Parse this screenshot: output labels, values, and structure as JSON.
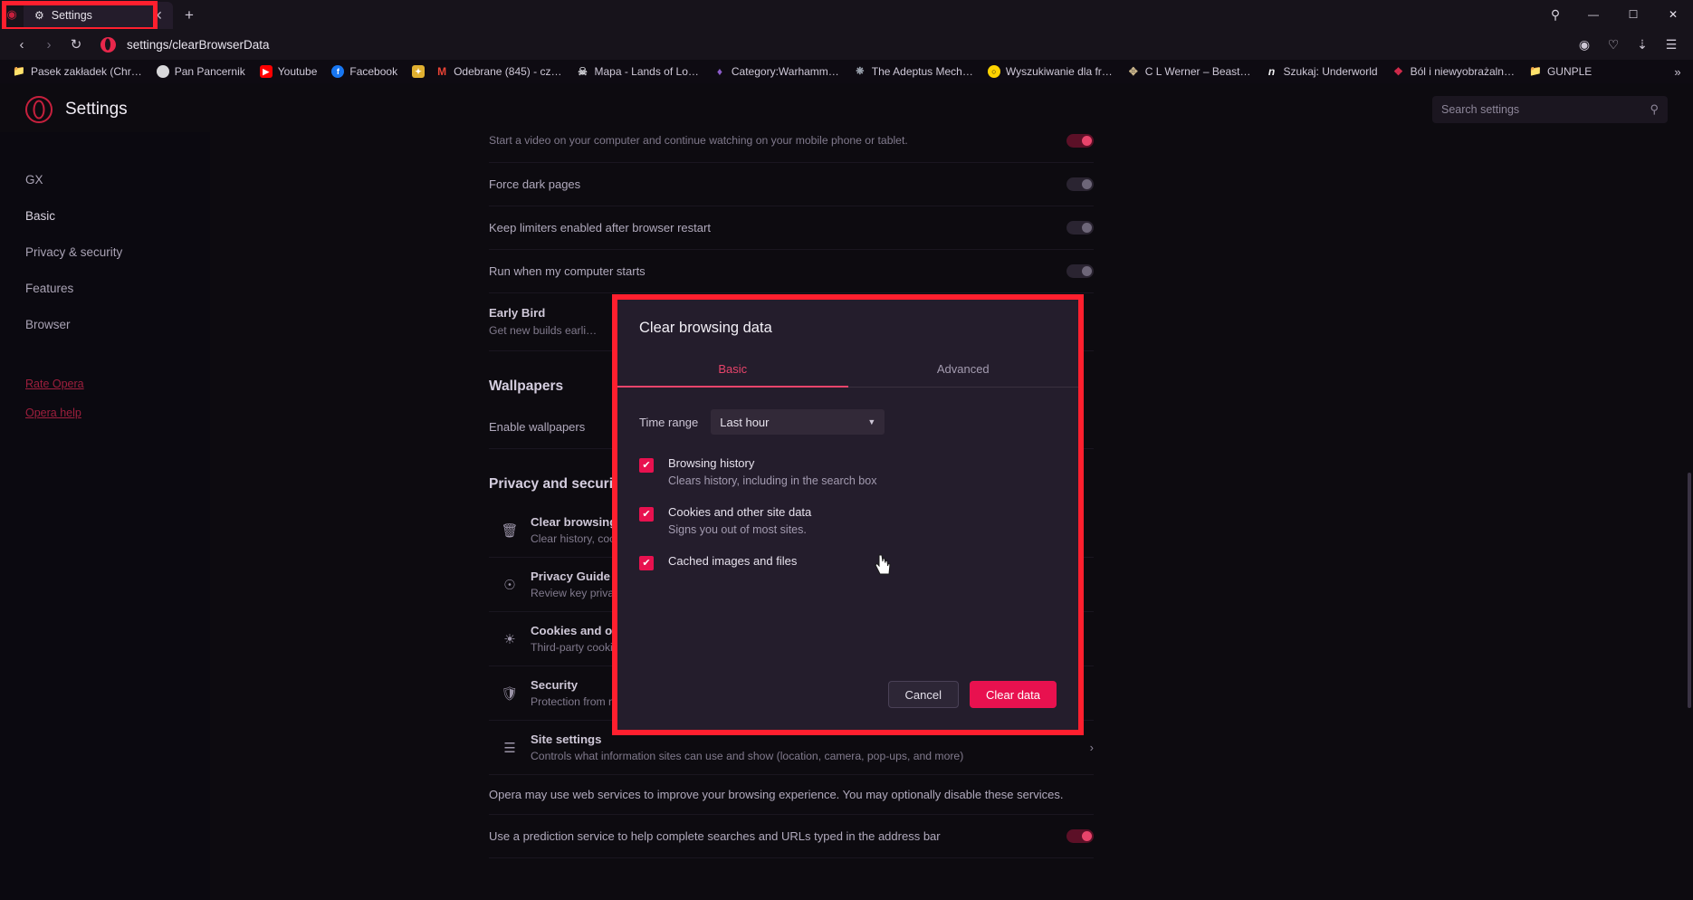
{
  "window": {
    "tab": {
      "title": "Settings",
      "icon": "gear-icon",
      "close": "✕"
    },
    "new_tab": "+",
    "controls": {
      "search": "⚲",
      "minimize": "—",
      "maximize": "☐",
      "close": "✕"
    }
  },
  "address_bar": {
    "back": "‹",
    "forward": "›",
    "reload": "↻",
    "url": "settings/clearBrowserData",
    "icons": [
      "camera-icon",
      "heart-icon",
      "download-icon",
      "menu-icon"
    ]
  },
  "bookmarks": {
    "items": [
      {
        "label": "Pasek zakładek (Chr…",
        "icon": "folder",
        "color": "none"
      },
      {
        "label": "Pan Pancernik",
        "icon": "circle",
        "color": "#d8d8da"
      },
      {
        "label": "Youtube",
        "icon": "play",
        "color": "#ff0000"
      },
      {
        "label": "Facebook",
        "icon": "f",
        "color": "#1877f2"
      },
      {
        "label": "",
        "icon": "gold",
        "color": "#e0b030"
      },
      {
        "label": "Odebrane (845) - cz…",
        "icon": "gmail",
        "color": "#ea4335"
      },
      {
        "label": "Mapa - Lands of Lo…",
        "icon": "skull",
        "color": "#cfcfd4"
      },
      {
        "label": "Category:Warhamm…",
        "icon": "gem",
        "color": "#8b5cc9"
      },
      {
        "label": "The Adeptus Mech…",
        "icon": "cog",
        "color": "#9aa2ad"
      },
      {
        "label": "Wyszukiwanie dla fr…",
        "icon": "ring",
        "color": "#ffd400"
      },
      {
        "label": "C L Werner – Beast…",
        "icon": "axe",
        "color": "#c8b48a"
      },
      {
        "label": "Szukaj: Underworld",
        "icon": "n",
        "color": "#f0f0f2"
      },
      {
        "label": "Ból i niewyobrażaln…",
        "icon": "paw",
        "color": "#d02a4a"
      },
      {
        "label": "GUNPLE",
        "icon": "folder",
        "color": "none"
      }
    ],
    "overflow": "»"
  },
  "settings_page": {
    "title": "Settings",
    "search_placeholder": "Search settings",
    "search_icon": "search-icon",
    "sidebar": {
      "items": [
        {
          "label": "GX",
          "active": false
        },
        {
          "label": "Basic",
          "active": true
        },
        {
          "label": "Privacy & security",
          "active": false
        },
        {
          "label": "Features",
          "active": false
        },
        {
          "label": "Browser",
          "active": false
        }
      ],
      "links": [
        {
          "label": "Rate Opera"
        },
        {
          "label": "Opera help"
        }
      ]
    },
    "rows": [
      {
        "type": "sub_only",
        "sub": "Start a video on your computer and continue watching on your mobile phone or tablet.",
        "toggle": "on"
      },
      {
        "type": "plain",
        "label": "Force dark pages",
        "toggle": "off"
      },
      {
        "type": "plain",
        "label": "Keep limiters enabled after browser restart",
        "toggle": "off"
      },
      {
        "type": "plain",
        "label": "Run when my computer starts",
        "toggle": "off"
      },
      {
        "type": "titled",
        "title": "Early Bird",
        "sub": "Get new builds earli…"
      }
    ],
    "sections": [
      {
        "heading": "Wallpapers",
        "rows": [
          {
            "type": "plain",
            "label": "Enable wallpapers"
          }
        ]
      },
      {
        "heading": "Privacy and security",
        "rows": [
          {
            "icon": "trash-icon",
            "title": "Clear browsing data",
            "sub": "Clear history, cookies, cache, and more"
          },
          {
            "icon": "target-icon",
            "title": "Privacy Guide",
            "sub": "Review key privacy and security controls"
          },
          {
            "icon": "cookie-icon",
            "title": "Cookies and other site data",
            "sub": "Third-party cookies are blocked"
          },
          {
            "icon": "shield-icon",
            "title": "Security",
            "sub": "Protection from malicious sites and other security settings"
          },
          {
            "icon": "sliders-icon",
            "title": "Site settings",
            "sub": "Controls what information sites can use and show (location, camera, pop-ups, and more)",
            "chevron": "›"
          }
        ]
      }
    ],
    "footer_rows": [
      {
        "type": "note",
        "label": "Opera may use web services to improve your browsing experience. You may optionally disable these services."
      },
      {
        "type": "plain",
        "label": "Use a prediction service to help complete searches and URLs typed in the address bar",
        "toggle": "on"
      }
    ]
  },
  "dialog": {
    "title": "Clear browsing data",
    "tabs": [
      {
        "label": "Basic",
        "active": true
      },
      {
        "label": "Advanced",
        "active": false
      }
    ],
    "time_range": {
      "label": "Time range",
      "value": "Last hour",
      "caret": "▼"
    },
    "checkboxes": [
      {
        "title": "Browsing history",
        "sub": "Clears history, including in the search box",
        "checked": true
      },
      {
        "title": "Cookies and other site data",
        "sub": "Signs you out of most sites.",
        "checked": true
      },
      {
        "title": "Cached images and files",
        "sub": "",
        "checked": true
      }
    ],
    "check_glyph": "✔",
    "buttons": {
      "cancel": "Cancel",
      "confirm": "Clear data"
    },
    "accent_color": "#e8114f",
    "highlight_color": "#ff1f2e"
  }
}
